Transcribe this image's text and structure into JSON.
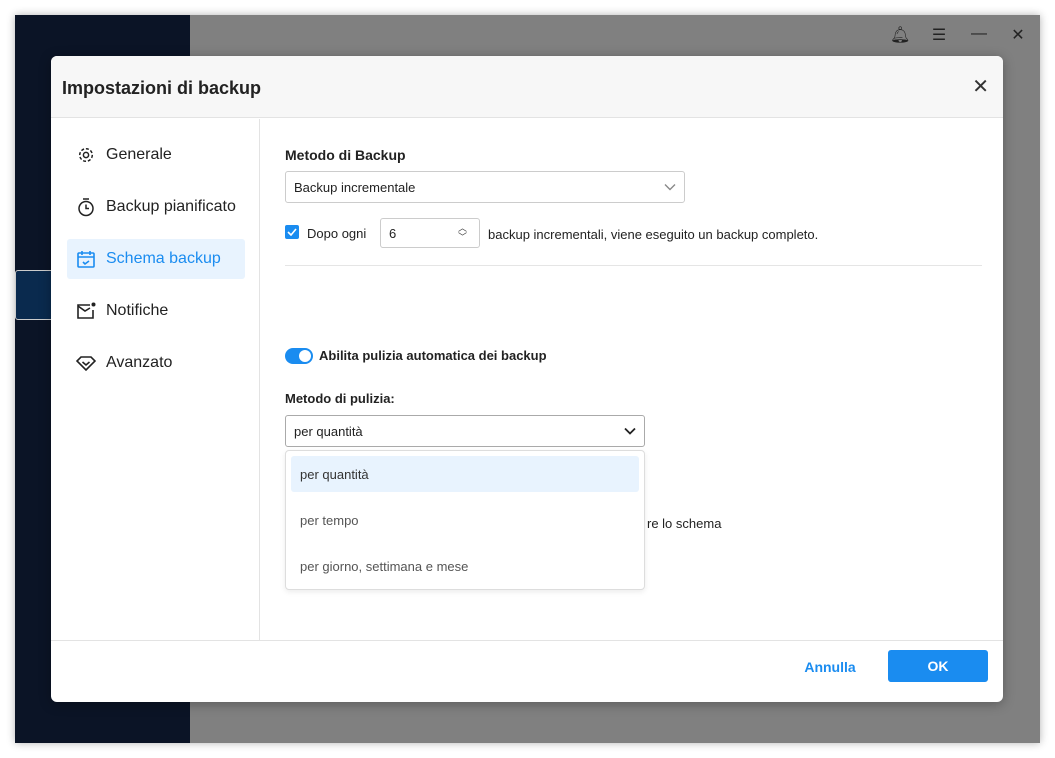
{
  "dialog": {
    "title": "Impostazioni di backup"
  },
  "nav": [
    {
      "label": "Generale",
      "icon": "gear-icon"
    },
    {
      "label": "Backup pianificato",
      "icon": "stopwatch-icon"
    },
    {
      "label": "Schema backup",
      "icon": "calendar-icon",
      "active": true
    },
    {
      "label": "Notifiche",
      "icon": "mail-icon"
    },
    {
      "label": "Avanzato",
      "icon": "diamond-icon"
    }
  ],
  "main": {
    "method_label": "Metodo di Backup",
    "method_value": "Backup incrementale",
    "after_label": "Dopo ogni",
    "after_value": "6",
    "after_suffix": "backup incrementali, viene eseguito un backup completo.",
    "cleanup_toggle_label": "Abilita pulizia automatica dei backup",
    "cleanup_method_label": "Metodo di pulizia:",
    "cleanup_method_value": "per quantità",
    "cleanup_options": [
      "per quantità",
      "per tempo",
      "per giorno, settimana e mese"
    ],
    "hidden_text_fragment": "re lo schema"
  },
  "footer": {
    "cancel": "Annulla",
    "ok": "OK"
  },
  "colors": {
    "accent": "#1a8cf0",
    "app_sidebar": "#0b1426"
  }
}
